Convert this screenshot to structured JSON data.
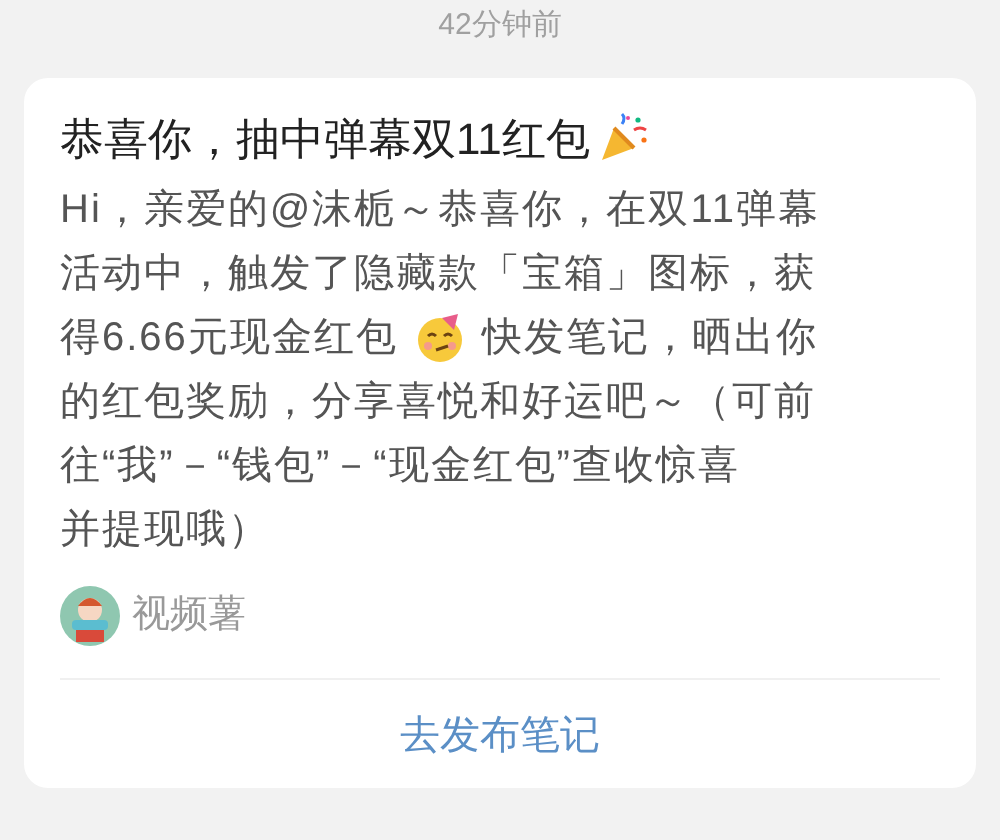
{
  "timestamp": "42分钟前",
  "card": {
    "title": "恭喜你，抽中弹幕双11红包",
    "body_lines": [
      {
        "segments": [
          {
            "kind": "text",
            "text": "Hi，亲爱的@沫栀～恭喜你，在双11弹幕"
          }
        ]
      },
      {
        "segments": [
          {
            "kind": "text",
            "text": "活动中，触发了隐藏款「宝箱」图标，获"
          }
        ]
      },
      {
        "segments": [
          {
            "kind": "text",
            "text": "得6.66元现金红包"
          },
          {
            "kind": "emoji"
          },
          {
            "kind": "text",
            "text": "快发笔记，晒出你"
          }
        ]
      },
      {
        "segments": [
          {
            "kind": "text",
            "text": "的红包奖励，分享喜悦和好运吧～（可前"
          }
        ]
      },
      {
        "segments": [
          {
            "kind": "text",
            "text": "往“我”－“钱包”－“现金红包”查收惊喜"
          }
        ]
      },
      {
        "segments": [
          {
            "kind": "text",
            "text": "并提现哦）"
          }
        ]
      }
    ],
    "source": "视频薯",
    "action": "去发布笔记"
  }
}
